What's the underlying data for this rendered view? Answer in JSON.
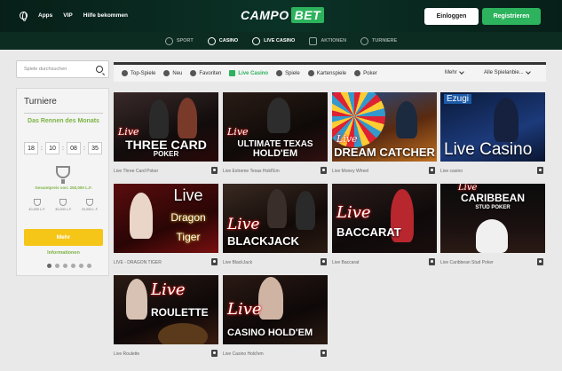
{
  "header": {
    "nav": [
      "Apps",
      "VIP",
      "Hilfe bekommen"
    ],
    "logo": {
      "part1": "CAMPO",
      "part2": "BET"
    },
    "login": "Einloggen",
    "register": "Registrieren"
  },
  "mainnav": [
    {
      "label": "SPORT",
      "icon": "soccer-ball-icon"
    },
    {
      "label": "CASINO",
      "icon": "casino-chip-icon"
    },
    {
      "label": "LIVE CASINO",
      "icon": "live-camera-icon"
    },
    {
      "label": "AKTIONEN",
      "icon": "gift-icon"
    },
    {
      "label": "TURNIERE",
      "icon": "trophy-icon"
    }
  ],
  "sidebar": {
    "search_placeholder": "Spiele durchsuchen",
    "tournament": {
      "title": "Turniere",
      "race": "Das Rennen des Monats",
      "timer": [
        "18",
        "10",
        "08",
        "35"
      ],
      "total": "Gesamtpreis von: 250,000 L.F.",
      "prizes": [
        "40,000 L.F.",
        "30,000 L.F.",
        "20,000 L.F."
      ],
      "more": "Mehr",
      "info": "Informationen"
    }
  },
  "filters": {
    "items": [
      {
        "label": "Top-Spiele"
      },
      {
        "label": "Neu"
      },
      {
        "label": "Favoriten"
      },
      {
        "label": "Live Casino",
        "active": true
      },
      {
        "label": "Spiele"
      },
      {
        "label": "Kartenspiele"
      },
      {
        "label": "Poker"
      }
    ],
    "more": "Mehr",
    "providers": "Alle Spielanbie..."
  },
  "games": [
    {
      "caption": "Live Three Card Poker",
      "live": "Live",
      "title": "THREE CARD",
      "sub": "POKER"
    },
    {
      "caption": "Live Extreme Texas Hold'Em",
      "live": "Live",
      "title": "ULTIMATE TEXAS",
      "sub": "HOLD'EM"
    },
    {
      "caption": "Live Money Wheel",
      "live": "Live",
      "title": "DREAM CATCHER",
      "sub": ""
    },
    {
      "caption": "Live casino",
      "live": "Ezugi",
      "title": "Live Casino",
      "sub": ""
    },
    {
      "caption": "LIVE - DRAGON TIGER",
      "live": "Live",
      "title": "Dragon",
      "sub": "Tiger"
    },
    {
      "caption": "Live BlackJack",
      "live": "Live",
      "title": "BLACKJACK",
      "sub": ""
    },
    {
      "caption": "Live Baccarat",
      "live": "Live",
      "title": "BACCARAT",
      "sub": ""
    },
    {
      "caption": "Live Caribbean Stud Poker",
      "live": "Live",
      "title": "CARIBBEAN",
      "sub": "STUD POKER"
    },
    {
      "caption": "Live Roulette",
      "live": "Live",
      "title": "ROULETTE",
      "sub": ""
    },
    {
      "caption": "Live Casino Hold'em",
      "live": "Live",
      "title": "CASINO HOLD'EM",
      "sub": ""
    }
  ]
}
